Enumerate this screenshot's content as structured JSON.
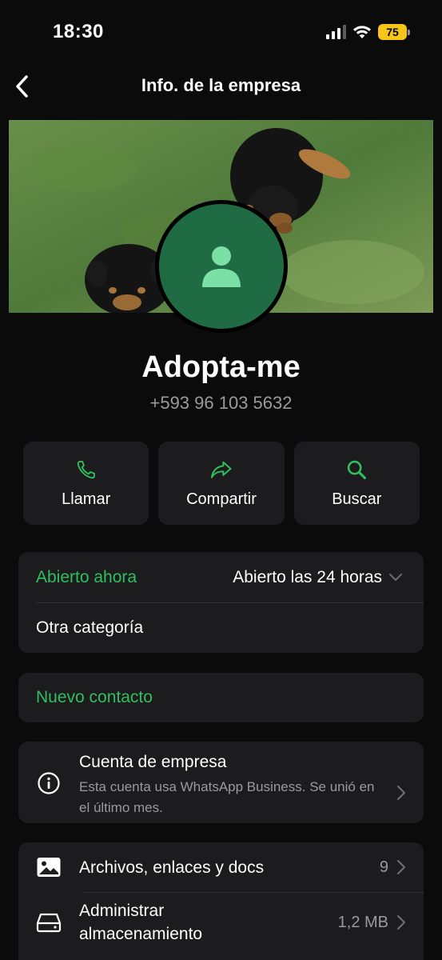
{
  "status_bar": {
    "time": "18:30",
    "battery": "75"
  },
  "nav": {
    "title": "Info. de la empresa"
  },
  "profile": {
    "name": "Adopta-me",
    "phone": "+593 96 103 5632"
  },
  "actions": [
    {
      "label": "Llamar",
      "icon": "phone-icon"
    },
    {
      "label": "Compartir",
      "icon": "share-icon"
    },
    {
      "label": "Buscar",
      "icon": "search-icon"
    }
  ],
  "hours_card": {
    "status": "Abierto ahora",
    "hours": "Abierto las 24 horas",
    "category": "Otra categoría"
  },
  "contact_card": {
    "label": "Nuevo contacto"
  },
  "business_card": {
    "title": "Cuenta de empresa",
    "description": "Esta cuenta usa WhatsApp Business. Se unió en el último mes."
  },
  "media_card": {
    "files": {
      "label": "Archivos, enlaces y docs",
      "value": "9"
    },
    "storage": {
      "label": "Administrar almacenamiento",
      "value": "1,2 MB"
    }
  },
  "colors": {
    "accent": "#2fbf5f",
    "card": "#1c1c1e",
    "background": "#0b0b0b",
    "avatar": "#1f6b43",
    "battery": "#f5c518"
  }
}
